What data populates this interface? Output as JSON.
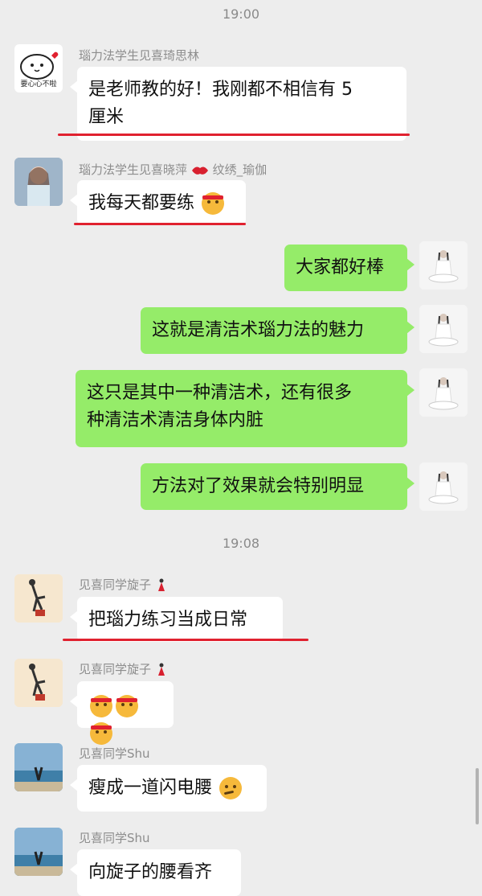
{
  "timestamps": [
    "19:00",
    "19:08"
  ],
  "messages": [
    {
      "sender": "瑙力法学生见喜琦思林",
      "text_a": "是老师教的好！我刚都不相信有 5",
      "text_b": "厘米"
    },
    {
      "sender_a": "瑙力法学生见喜晓萍",
      "sender_b": "纹绣_瑜伽",
      "text": "我每天都要练"
    },
    {
      "text": "大家都好棒"
    },
    {
      "text": "这就是清洁术瑙力法的魅力"
    },
    {
      "text_a": "这只是其中一种清洁术，还有很多",
      "text_b": "种清洁术清洁身体内脏"
    },
    {
      "text": "方法对了效果就会特别明显"
    },
    {
      "sender": "见喜同学旋子",
      "text": "把瑙力练习当成日常"
    },
    {
      "sender": "见喜同学旋子",
      "emojis": [
        "shushing-face",
        "shushing-face",
        "shushing-face"
      ]
    },
    {
      "sender": "见喜同学Shu",
      "text": "瘦成一道闪电腰"
    },
    {
      "sender": "见喜同学Shu",
      "text": "向旋子的腰看齐"
    }
  ],
  "avatars": {
    "cartoon_label": "要心心不啦"
  },
  "colors": {
    "background": "#ededed",
    "outgoing_bubble": "#95ec69",
    "incoming_bubble": "#ffffff",
    "highlight_underline": "#e0212f"
  }
}
